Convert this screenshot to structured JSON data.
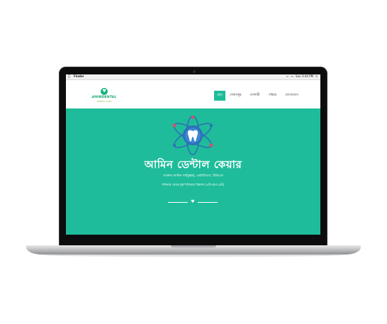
{
  "menubar": {
    "apple_icon": "apple-icon",
    "app_name": "Finder",
    "time": "Sun 3:44 PM"
  },
  "logo": {
    "name": "AMINDENTAL",
    "tagline": "DENTAL CARE"
  },
  "nav": {
    "items": [
      {
        "label": "হোম",
        "active": true
      },
      {
        "label": "সেবাসমূহ",
        "active": false
      },
      {
        "label": "গ্যালারী",
        "active": false
      },
      {
        "label": "পরিচয়",
        "active": false
      },
      {
        "label": "যোগাযোগ",
        "active": false
      }
    ]
  },
  "hero": {
    "title": "আমিন ডেন্টাল কেয়ার",
    "subtitle_line1": "ডাক্তার আমিন সাইফুল্লাহ, এমবিবিএস, বিডিএস",
    "subtitle_line2": "শনিবার থেকে বৃহস্পতিবার বিকাল (৪টা-রাত ৯টা)",
    "divider_icon": "tooth-icon"
  },
  "colors": {
    "accent": "#1ebc9a",
    "logo_green": "#1aa66d",
    "atom_blue": "#2f6fb7"
  }
}
